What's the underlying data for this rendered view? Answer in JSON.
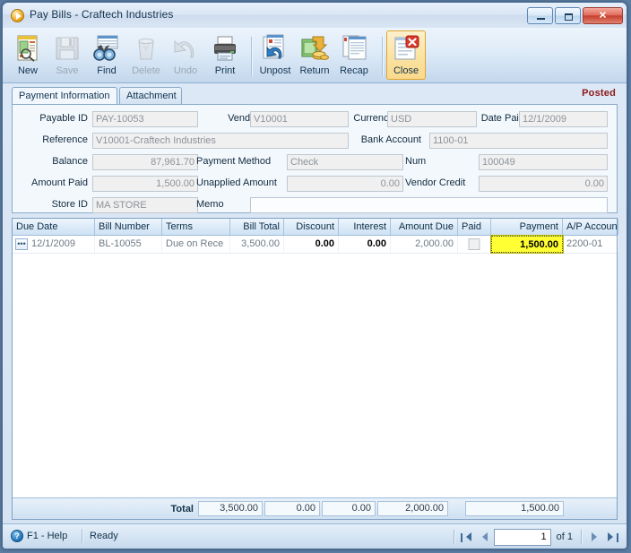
{
  "window": {
    "title": "Pay Bills - Craftech Industries",
    "app_icon": "play-circle-icon",
    "buttons": {
      "minimize": "minimize-icon",
      "maximize": "maximize-icon",
      "close": "✕"
    }
  },
  "toolbar": {
    "items": [
      {
        "label": "New",
        "icon": "new-document-icon",
        "disabled": false,
        "active": false
      },
      {
        "label": "Save",
        "icon": "floppy-disk-icon",
        "disabled": true,
        "active": false
      },
      {
        "label": "Find",
        "icon": "binoculars-icon",
        "disabled": false,
        "active": false
      },
      {
        "label": "Delete",
        "icon": "trash-can-icon",
        "disabled": true,
        "active": false
      },
      {
        "label": "Undo",
        "icon": "undo-arrow-icon",
        "disabled": true,
        "active": false
      },
      {
        "label": "Print",
        "icon": "printer-icon",
        "disabled": false,
        "active": false
      }
    ],
    "items2": [
      {
        "label": "Unpost",
        "icon": "unpost-arrow-icon",
        "disabled": false,
        "active": false
      },
      {
        "label": "Return",
        "icon": "money-return-icon",
        "disabled": false,
        "active": false
      },
      {
        "label": "Recap",
        "icon": "recap-pages-icon",
        "disabled": false,
        "active": false
      }
    ],
    "items3": [
      {
        "label": "Close",
        "icon": "close-document-icon",
        "disabled": false,
        "active": true
      }
    ]
  },
  "tabs": [
    {
      "label": "Payment Information",
      "selected": true
    },
    {
      "label": "Attachment",
      "selected": false
    }
  ],
  "status_flag": "Posted",
  "form": {
    "payable_id": {
      "label": "Payable ID",
      "value": "PAY-10053"
    },
    "vendor_id": {
      "label": "Vendor ID",
      "value": "V10001"
    },
    "currency": {
      "label": "Currency",
      "value": "USD"
    },
    "date_paid": {
      "label": "Date Paid",
      "value": "12/1/2009"
    },
    "reference": {
      "label": "Reference",
      "value": "V10001-Craftech Industries"
    },
    "bank_account": {
      "label": "Bank Account",
      "value": "1100-01"
    },
    "balance": {
      "label": "Balance",
      "value": "87,961.70"
    },
    "payment_method": {
      "label": "Payment Method",
      "value": "Check"
    },
    "num": {
      "label": "Num",
      "value": "100049"
    },
    "amount_paid": {
      "label": "Amount Paid",
      "value": "1,500.00"
    },
    "unapplied_amount": {
      "label": "Unapplied Amount",
      "value": "0.00"
    },
    "vendor_credit": {
      "label": "Vendor Credit",
      "value": "0.00"
    },
    "store_id": {
      "label": "Store ID",
      "value": "MA STORE"
    },
    "memo": {
      "label": "Memo",
      "value": ""
    }
  },
  "grid": {
    "columns": [
      "Due Date",
      "Bill Number",
      "Terms",
      "Bill Total",
      "Discount",
      "Interest",
      "Amount Due",
      "Paid",
      "Payment",
      "A/P Account"
    ],
    "rows": [
      {
        "due_date": "12/1/2009",
        "bill_number": "BL-10055",
        "terms": "Due on Rece",
        "bill_total": "3,500.00",
        "discount": "0.00",
        "interest": "0.00",
        "amount_due": "2,000.00",
        "paid": false,
        "payment": "1,500.00",
        "ap_account": "2200-01",
        "row_menu_icon": "ellipsis-button-icon"
      }
    ],
    "totals": {
      "label": "Total",
      "bill_total": "3,500.00",
      "discount": "0.00",
      "interest": "0.00",
      "amount_due": "2,000.00",
      "payment": "1,500.00"
    },
    "selected_cell": {
      "column": "Payment",
      "value": "1,500.00",
      "highlight_color": "#ffff33"
    }
  },
  "statusbar": {
    "help_icon": "help-circle-icon",
    "help_label": "F1 - Help",
    "status": "Ready",
    "nav": {
      "first": "first-page-icon",
      "prev": "previous-page-icon",
      "page_value": "1",
      "of_label": "of 1",
      "next": "next-page-icon",
      "last": "last-page-icon"
    }
  },
  "colors": {
    "accent": "#4e87c4",
    "posted": "#8c1818",
    "selection": "#ffff33",
    "active_toolbar": "#f9d98c"
  }
}
